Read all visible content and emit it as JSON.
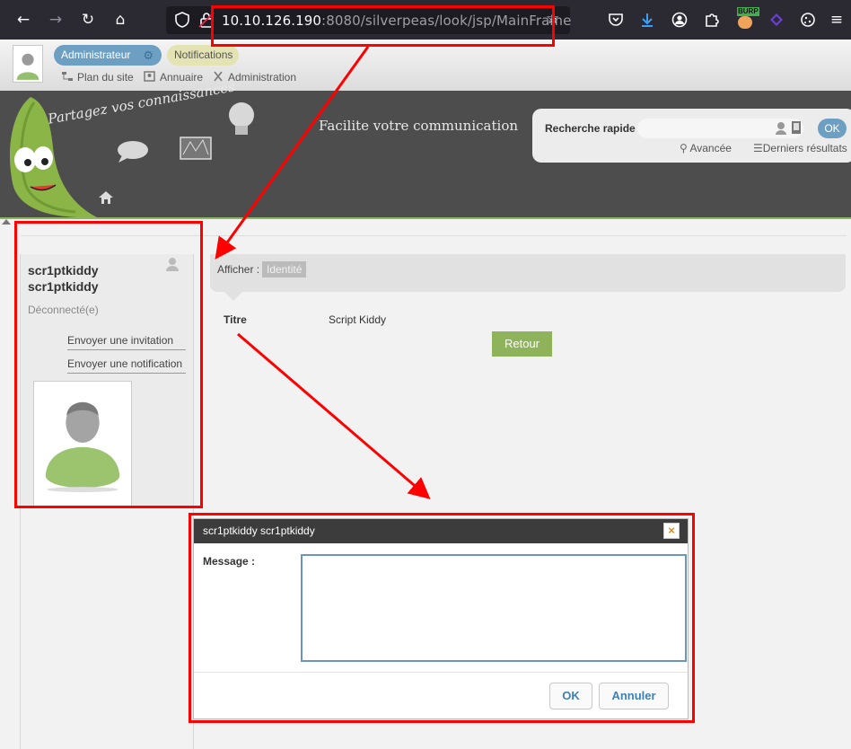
{
  "browser": {
    "url_host": "10.10.126.190",
    "url_rest": ":8080/silverpeas/look/jsp/MainFrame",
    "extension_badge": "BURP"
  },
  "topbar": {
    "admin_label": "Administrateur",
    "notifications_label": "Notifications",
    "links": [
      "Plan du site",
      "Annuaire",
      "Administration"
    ]
  },
  "banner": {
    "slogan_left": "Partagez vos connaissances",
    "slogan_center": "Facilite votre communication"
  },
  "search": {
    "label": "Recherche rapide",
    "ok_label": "OK",
    "advanced_label": "Avancée",
    "last_results_label": "Derniers résultats"
  },
  "profile": {
    "first_name": "scr1ptkiddy",
    "last_name": "scr1ptkiddy",
    "status": "Déconnecté(e)",
    "invite_link": "Envoyer une invitation",
    "notify_link": "Envoyer une notification"
  },
  "main": {
    "afficher_label": "Afficher :",
    "identity_tab": "Identité",
    "title_label": "Titre",
    "title_value": "Script Kiddy",
    "back_button": "Retour"
  },
  "dialog": {
    "title": "scr1ptkiddy scr1ptkiddy",
    "close_glyph": "×",
    "message_label": "Message :",
    "ok_button": "OK",
    "cancel_button": "Annuler"
  },
  "colors": {
    "annotation_red": "#ff0000",
    "accent_blue": "#6d9fc3",
    "accent_green": "#8fb35b",
    "banner_dark": "#4d4d4d"
  }
}
